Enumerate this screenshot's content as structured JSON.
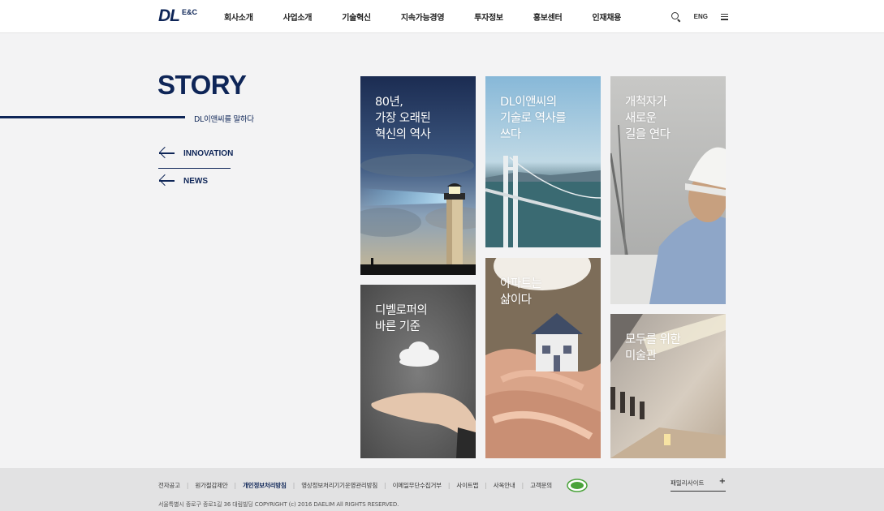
{
  "header": {
    "logo_main": "DL",
    "logo_sub": "E&C",
    "nav": [
      "회사소개",
      "사업소개",
      "기술혁신",
      "지속가능경영",
      "투자정보",
      "홍보센터",
      "인재채용"
    ],
    "lang": "ENG",
    "icons": [
      "search-icon",
      "menu-icon"
    ]
  },
  "story": {
    "title": "STORY",
    "subtitle": "DL이앤씨를 말하다",
    "links": [
      "INNOVATION",
      "NEWS"
    ]
  },
  "tiles": [
    {
      "id": "history",
      "text": "80년,\n가장 오래된\n혁신의 역사"
    },
    {
      "id": "technology",
      "text": "DL이앤씨의\n기술로 역사를\n쓰다"
    },
    {
      "id": "pioneer",
      "text": "개척자가\n새로운\n길을 연다"
    },
    {
      "id": "developer",
      "text": "디벨로퍼의\n바른 기준"
    },
    {
      "id": "apartment",
      "text": "아파트는\n삶이다"
    },
    {
      "id": "museum",
      "text": "모두를 위한\n미술관"
    }
  ],
  "footer": {
    "links": [
      "전자공고",
      "원가절감제안",
      "개인정보처리방침",
      "영상정보처리기기운영관리방침",
      "이메일무단수집거부",
      "사이트맵",
      "사옥안내",
      "고객문의"
    ],
    "bold_link_index": 2,
    "family_site": "패밀리사이트",
    "family_plus": "+",
    "copyright": "서울특별시 종로구 종로1길 36 대림빌딩 COPYRIGHT (c) 2016 DAELIM All RIGHTS RESERVED."
  },
  "colors": {
    "brand_navy": "#0e2557",
    "page_bg": "#f3f3f4",
    "footer_bg": "#e2e2e3"
  }
}
